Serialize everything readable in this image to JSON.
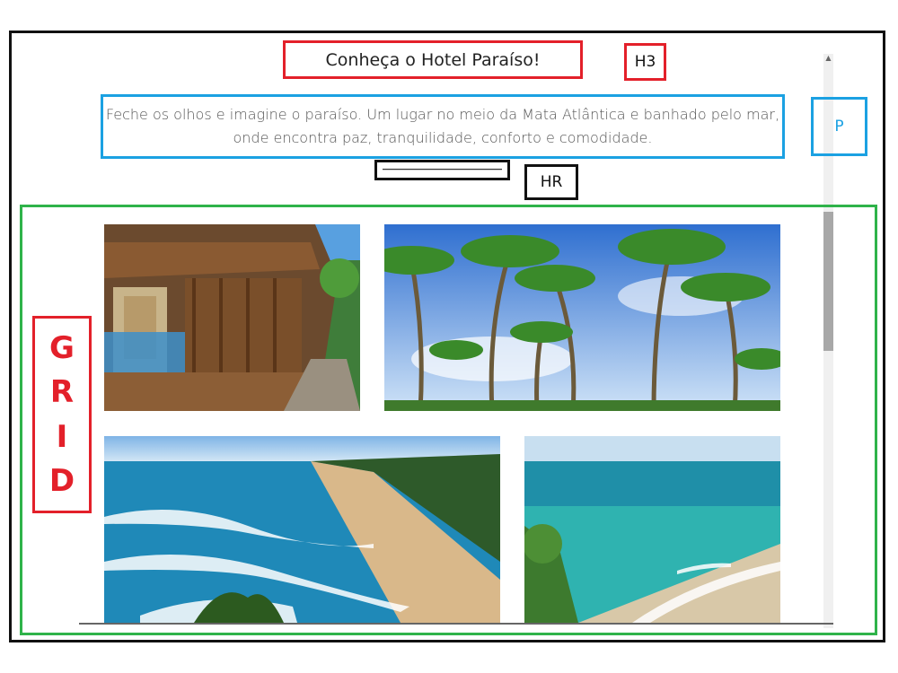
{
  "heading": {
    "text": "Conheça o Hotel Paraíso!",
    "annotation": "H3"
  },
  "paragraph": {
    "text": "Feche os olhos e imagine o paraíso. Um lugar no meio da Mata Atlântica e banhado pelo mar, onde encontra paz, tranquilidade, conforto e comodidade.",
    "annotation": "P"
  },
  "rule": {
    "annotation": "HR"
  },
  "grid": {
    "annotation_letters": [
      "G",
      "R",
      "I",
      "D"
    ],
    "images": [
      {
        "icon": "hotel-balcony-image"
      },
      {
        "icon": "palm-trees-image"
      },
      {
        "icon": "beach-waves-image"
      },
      {
        "icon": "turquoise-sea-image"
      }
    ]
  },
  "colors": {
    "heading_annotation": "#e3202a",
    "paragraph_annotation": "#1ba1e2",
    "rule_annotation": "#111111",
    "grid_annotation": "#2fb34a",
    "grid_label": "#e3202a"
  }
}
